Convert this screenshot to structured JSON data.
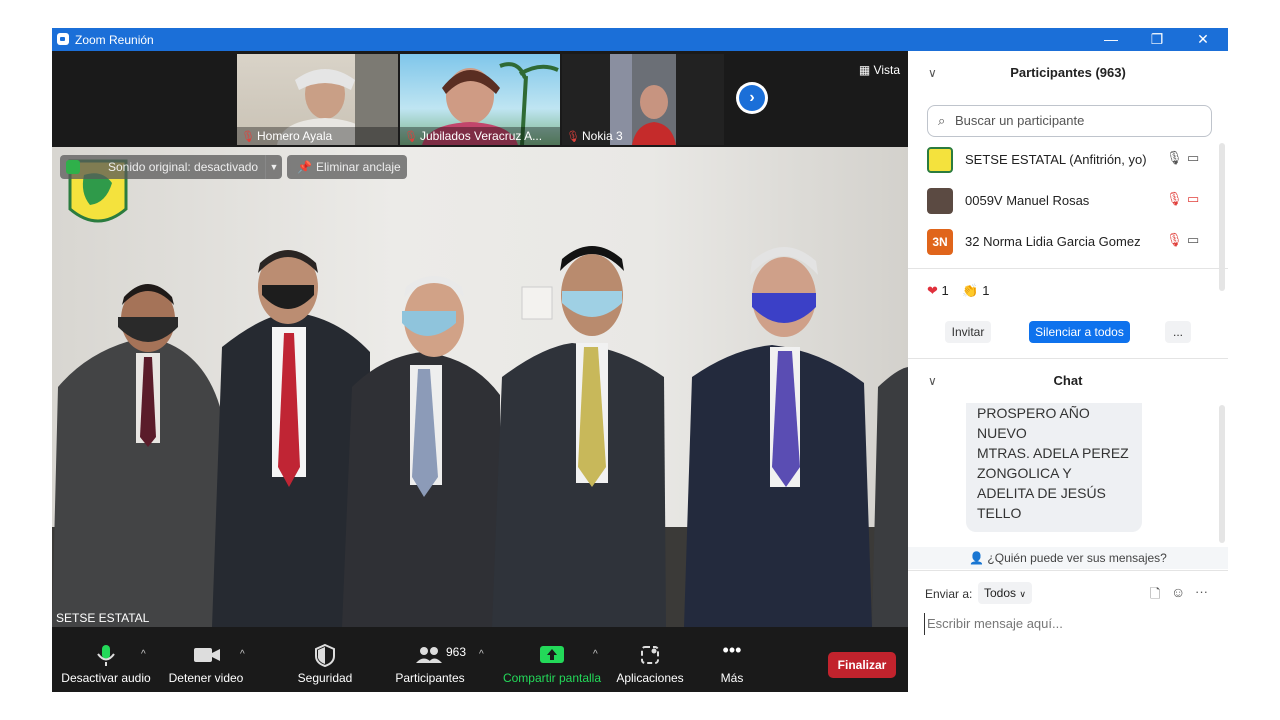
{
  "window": {
    "title": "Zoom Reunión",
    "controls": [
      "—",
      "❐",
      "✕"
    ]
  },
  "gallery": {
    "thumbnails": [
      {
        "name": "Homero Ayala",
        "muted": true
      },
      {
        "name": "Jubilados Veracruz A...",
        "muted": true
      },
      {
        "name": "Nokia 3",
        "muted": true
      }
    ],
    "view_label": "Vista"
  },
  "main_video": {
    "original_sound": "Sonido original: desactivado",
    "unpin_label": "Eliminar anclaje",
    "speaker_name": "SETSE ESTATAL"
  },
  "toolbar": {
    "mute_label": "Desactivar audio",
    "video_label": "Detener video",
    "security_label": "Seguridad",
    "participants_label": "Participantes",
    "participants_count": "963",
    "share_label": "Compartir pantalla",
    "apps_label": "Aplicaciones",
    "more_label": "Más",
    "end_label": "Finalizar"
  },
  "participants_panel": {
    "title": "Participantes (963)",
    "search_placeholder": "Buscar un participante",
    "list": [
      {
        "name": "SETSE ESTATAL (Anfitrión, yo)",
        "avatar": "logo",
        "mic_muted": false,
        "video_off": false
      },
      {
        "name": "0059V Manuel Rosas",
        "avatar": "photo",
        "mic_muted": true,
        "video_off": true
      },
      {
        "name": "32 Norma Lidia Garcia Gomez",
        "avatar": "3N",
        "mic_muted": true,
        "video_off": false
      }
    ],
    "reactions": [
      {
        "icon": "❤",
        "count": "1"
      },
      {
        "icon": "👏",
        "count": "1"
      }
    ],
    "invite_label": "Invitar",
    "mute_all_label": "Silenciar a todos",
    "more_label": "..."
  },
  "chat": {
    "title": "Chat",
    "message_lines": [
      "PROSPERO AÑO",
      "NUEVO",
      "MTRAS. ADELA PEREZ",
      "ZONGOLICA Y",
      "ADELITA DE JESÚS",
      "TELLO"
    ],
    "visibility_note": "¿Quién puede ver sus mensajes?",
    "send_to_label": "Enviar a:",
    "send_to_value": "Todos",
    "input_placeholder": "Escribir mensaje aquí..."
  },
  "colors": {
    "title_bar": "#1b6fd8",
    "end_button": "#c2232d",
    "share_icon": "#23d959",
    "mute_all_button": "#0e72ed"
  }
}
